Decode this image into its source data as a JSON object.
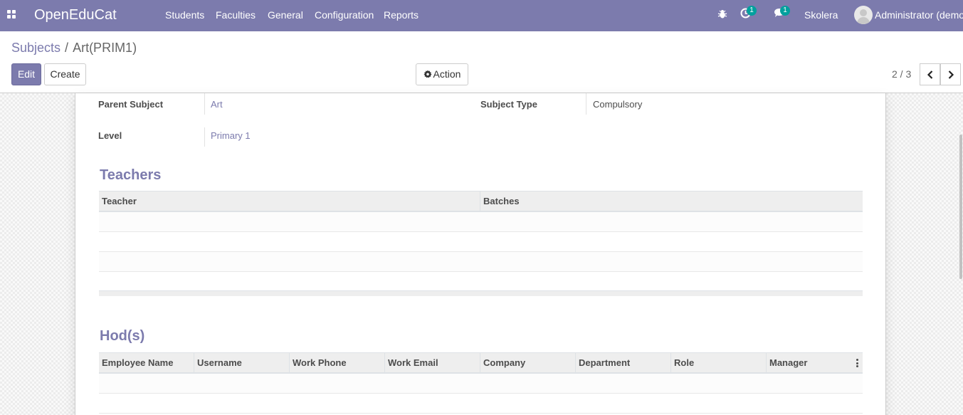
{
  "navbar": {
    "brand": "OpenEduCat",
    "menu": [
      {
        "label": "Students"
      },
      {
        "label": "Faculties"
      },
      {
        "label": "General"
      },
      {
        "label": "Configuration"
      },
      {
        "label": "Reports"
      }
    ],
    "activity_count": "1",
    "message_count": "1",
    "company": "Skolera",
    "user": "Administrator (demo)",
    "icons": [
      "apps-icon",
      "bug-icon",
      "clock-icon",
      "chat-icon",
      "avatar"
    ]
  },
  "breadcrumb": {
    "parent": "Subjects",
    "separator": "/",
    "current": "Art(PRIM1)"
  },
  "toolbar": {
    "edit_label": "Edit",
    "create_label": "Create",
    "action_label": "Action"
  },
  "pager": {
    "value": "2 / 3"
  },
  "form": {
    "parent_subject_label": "Parent Subject",
    "parent_subject_value": "Art",
    "subject_type_label": "Subject Type",
    "subject_type_value": "Compulsory",
    "level_label": "Level",
    "level_value": "Primary 1"
  },
  "teachers": {
    "title": "Teachers",
    "columns": [
      "Teacher",
      "Batches"
    ]
  },
  "hods": {
    "title": "Hod(s)",
    "columns": [
      "Employee Name",
      "Username",
      "Work Phone",
      "Work Email",
      "Company",
      "Department",
      "Role",
      "Manager"
    ]
  },
  "colors": {
    "brand": "#7c7bad",
    "badge": "#00a09d"
  }
}
